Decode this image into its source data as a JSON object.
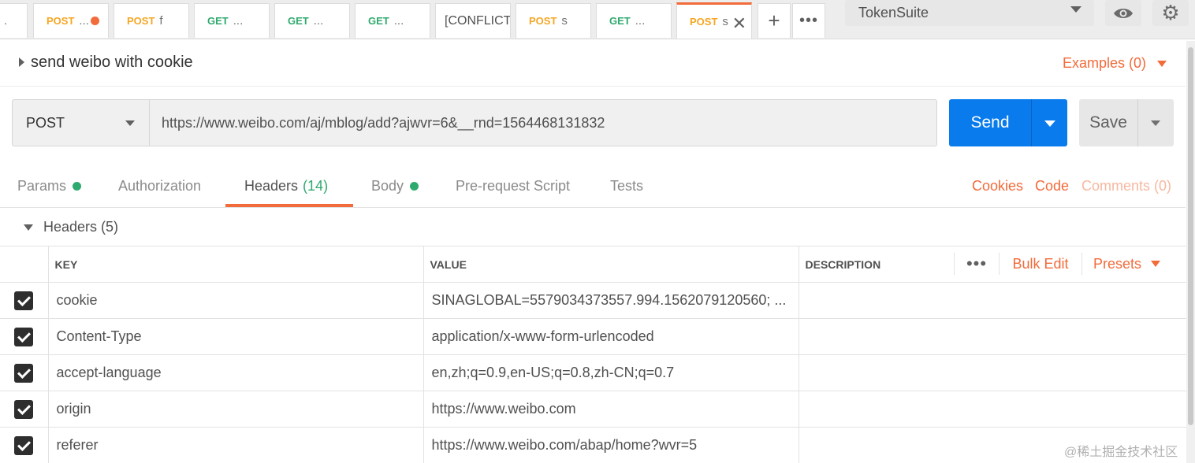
{
  "tabs": [
    {
      "method": "",
      "name": ".",
      "method_type": "none"
    },
    {
      "method": "POST",
      "name": "...",
      "method_type": "post",
      "unsaved": true
    },
    {
      "method": "POST",
      "name": "f",
      "method_type": "post"
    },
    {
      "method": "GET",
      "name": "...",
      "method_type": "get"
    },
    {
      "method": "GET",
      "name": "...",
      "method_type": "get"
    },
    {
      "method": "GET",
      "name": "...",
      "method_type": "get"
    },
    {
      "method": "",
      "name": "[CONFLICT",
      "method_type": "none"
    },
    {
      "method": "POST",
      "name": "s",
      "method_type": "post"
    },
    {
      "method": "GET",
      "name": "...",
      "method_type": "get"
    },
    {
      "method": "POST",
      "name": "s",
      "method_type": "post",
      "active": true
    }
  ],
  "toolbar": {
    "new_tab_icon": "plus-icon",
    "more_tabs_icon": "ellipsis-icon",
    "environment": "TokenSuite",
    "eye_icon": "eye-icon",
    "settings_icon": "gear-icon"
  },
  "request": {
    "name": "send weibo with cookie",
    "examples_label": "Examples (0)",
    "method": "POST",
    "url": "https://www.weibo.com/aj/mblog/add?ajwvr=6&__rnd=1564468131832",
    "send_label": "Send",
    "save_label": "Save"
  },
  "subtabs": {
    "params": "Params",
    "authorization": "Authorization",
    "headers": "Headers",
    "headers_count": "(14)",
    "body": "Body",
    "prerequest": "Pre-request Script",
    "tests": "Tests",
    "cookies": "Cookies",
    "code": "Code",
    "comments": "Comments (0)"
  },
  "headers_section": {
    "label": "Headers (5)",
    "columns": {
      "key": "KEY",
      "value": "VALUE",
      "description": "DESCRIPTION"
    },
    "bulk_edit": "Bulk Edit",
    "presets": "Presets",
    "rows": [
      {
        "key": "cookie",
        "value": "SINAGLOBAL=5579034373557.994.1562079120560; ...",
        "description": ""
      },
      {
        "key": "Content-Type",
        "value": "application/x-www-form-urlencoded",
        "description": ""
      },
      {
        "key": "accept-language",
        "value": "en,zh;q=0.9,en-US;q=0.8,zh-CN;q=0.7",
        "description": ""
      },
      {
        "key": "origin",
        "value": "https://www.weibo.com",
        "description": ""
      },
      {
        "key": "referer",
        "value": "https://www.weibo.com/abap/home?wvr=5",
        "description": ""
      }
    ]
  },
  "watermark": "@稀土掘金技术社区",
  "colors": {
    "accent": "#f26b3a",
    "send": "#097bed",
    "get": "#2faa6e",
    "post": "#f6a623"
  }
}
